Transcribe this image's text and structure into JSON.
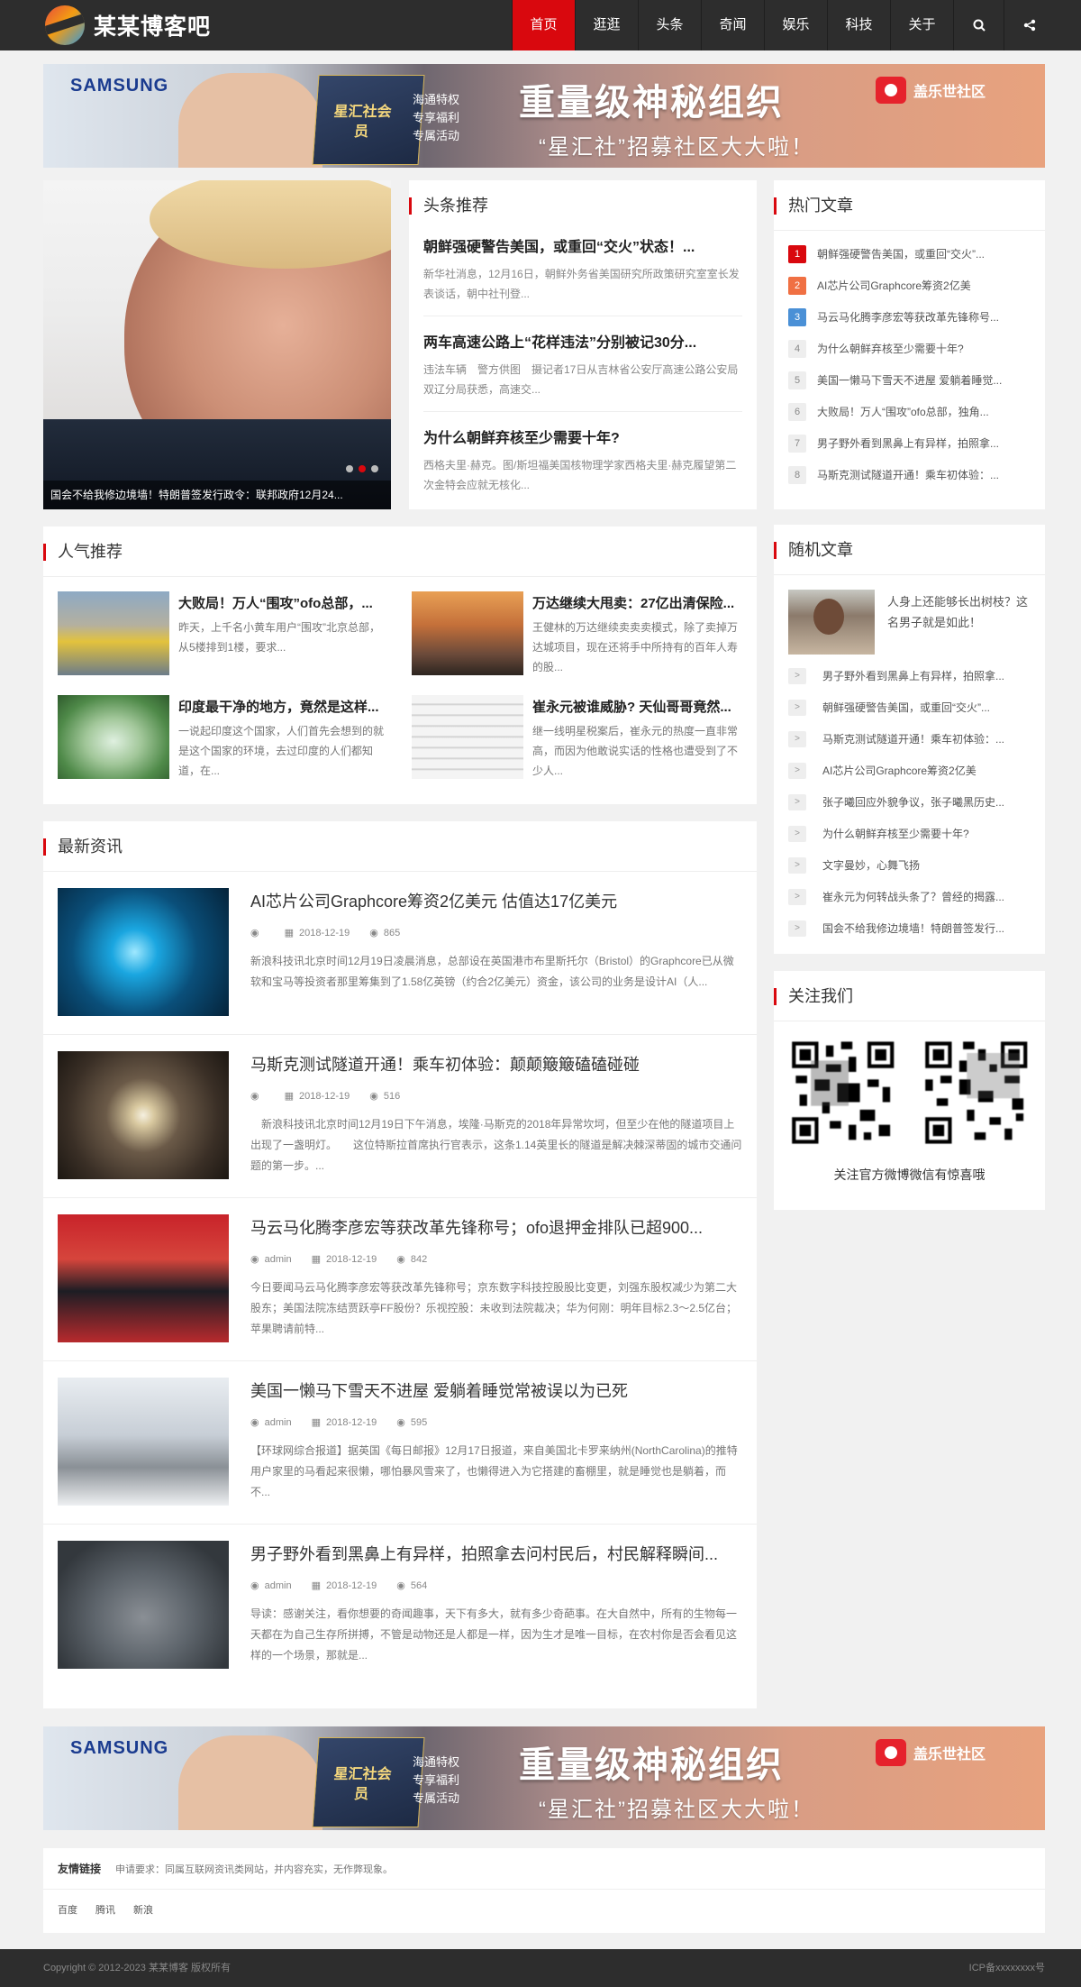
{
  "site": {
    "name": "某某博客吧"
  },
  "nav": {
    "items": [
      "首页",
      "逛逛",
      "头条",
      "奇闻",
      "娱乐",
      "科技",
      "关于"
    ],
    "active": 0,
    "search_icon": "search-icon",
    "share_icon": "share-icon"
  },
  "banner": {
    "brand_left": "SAMSUNG",
    "card": "星汇社会员",
    "perks": [
      "海通特权",
      "专享福利",
      "专属活动"
    ],
    "headline": "重量级神秘组织",
    "subline": "“星汇社”招募社区大大啦！",
    "brand_right": "盖乐世社区"
  },
  "slider": {
    "caption": "国会不给我修边境墙！特朗普签发行政令：联邦政府12月24..."
  },
  "headlines": {
    "title": "头条推荐",
    "items": [
      {
        "title": "朝鲜强硬警告美国，或重回“交火”状态！...",
        "desc": "新华社消息，12月16日，朝鲜外务省美国研究所政策研究室室长发表谈话，朝中社刊登..."
      },
      {
        "title": "两车高速公路上“花样违法”分别被记30分...",
        "desc": "违法车辆　警方供图　摄记者17日从吉林省公安厅高速公路公安局双辽分局获悉，高速交..."
      },
      {
        "title": "为什么朝鲜弃核至少需要十年?",
        "desc": "西格夫里·赫克。图/斯坦福美国核物理学家西格夫里·赫克履望第二次金特会应就无核化..."
      }
    ]
  },
  "hot": {
    "title": "热门文章",
    "items": [
      "朝鲜强硬警告美国，或重回“交火”...",
      "AI芯片公司Graphcore筹资2亿美",
      "马云马化腾李彦宏等获改革先锋称号...",
      "为什么朝鲜弃核至少需要十年?",
      "美国一懒马下雪天不进屋 爱躺着睡觉...",
      "大败局！万人“围攻”ofo总部，独角...",
      "男子野外看到黑鼻上有异样，拍照拿...",
      "马斯克测试隧道开通！乘车初体验：..."
    ]
  },
  "popular": {
    "title": "人气推荐",
    "items": [
      {
        "title": "大败局！万人“围攻”ofo总部，...",
        "desc": "昨天，上千名小黄车用户“围攻”北京总部，从5楼排到1楼，要求..."
      },
      {
        "title": "万达继续大甩卖：27亿出清保险...",
        "desc": "王健林的万达继续卖卖卖模式，除了卖掉万达城项目，现在还将手中所持有的百年人寿的股..."
      },
      {
        "title": "印度最干净的地方，竟然是这样...",
        "desc": "一说起印度这个国家，人们首先会想到的就是这个国家的环境，去过印度的人们都知道，在..."
      },
      {
        "title": "崔永元被谁威胁? 天仙哥哥竟然...",
        "desc": "继一线明星税案后，崔永元的热度一直非常高，而因为他敢说实话的性格也遭受到了不少人..."
      }
    ]
  },
  "latest": {
    "title": "最新资讯",
    "items": [
      {
        "title": "AI芯片公司Graphcore筹资2亿美元 估值达17亿美元",
        "author": "",
        "date": "2018-12-19",
        "views": "865",
        "desc": "新浪科技讯北京时间12月19日凌晨消息，总部设在英国港市布里斯托尔（Bristol）的Graphcore已从微软和宝马等投资者那里筹集到了1.58亿英镑（约合2亿美元）资金，该公司的业务是设计AI（人..."
      },
      {
        "title": "马斯克测试隧道开通！乘车初体验：颠颠簸簸磕磕碰碰",
        "author": "",
        "date": "2018-12-19",
        "views": "516",
        "desc": "　新浪科技讯北京时间12月19日下午消息，埃隆·马斯克的2018年异常坎坷，但至少在他的隧道项目上出现了一盏明灯。　　这位特斯拉首席执行官表示，这条1.14英里长的隧道是解决棘深蒂固的城市交通问题的第一步。..."
      },
      {
        "title": "马云马化腾李彦宏等获改革先锋称号；ofo退押金排队已超900...",
        "author": "admin",
        "date": "2018-12-19",
        "views": "842",
        "desc": "今日要闻马云马化腾李彦宏等获改革先锋称号；京东数字科技控股股比变更，刘强东股权减少为第二大股东；美国法院冻结贾跃亭FF股份？乐视控股：未收到法院裁决；华为何刚：明年目标2.3～2.5亿台；苹果聘请前特..."
      },
      {
        "title": "美国一懒马下雪天不进屋 爱躺着睡觉常被误以为已死",
        "author": "admin",
        "date": "2018-12-19",
        "views": "595",
        "desc": "【环球网综合报道】据英国《每日邮报》12月17日报道，来自美国北卡罗来纳州(NorthCarolina)的推特用户家里的马看起来很懒，哪怕暴风雪来了，也懒得进入为它搭建的畜棚里，就是睡觉也是躺着，而不..."
      },
      {
        "title": "男子野外看到黑鼻上有异样，拍照拿去问村民后，村民解释瞬间...",
        "author": "admin",
        "date": "2018-12-19",
        "views": "564",
        "desc": "导读：感谢关注，看你想要的奇闻趣事，天下有多大，就有多少奇葩事。在大自然中，所有的生物每一天都在为自己生存所拼搏，不管是动物还是人都是一样，因为生才是唯一目标，在农村你是否会看见这样的一个场景，那就是..."
      }
    ]
  },
  "random": {
    "title": "随机文章",
    "top": "人身上还能够长出树枝？这名男子就是如此！",
    "items": [
      "男子野外看到黑鼻上有异样，拍照拿...",
      "朝鲜强硬警告美国，或重回“交火”...",
      "马斯克测试隧道开通！乘车初体验：...",
      "AI芯片公司Graphcore筹资2亿美",
      "张子曦回应外貌争议，张子曦黑历史...",
      "为什么朝鲜弃核至少需要十年?",
      "文字曼妙，心舞飞扬",
      "崔永元为何转战头条了？曾经的揭露...",
      "国会不给我修边境墙！特朗普签发行..."
    ]
  },
  "follow": {
    "title": "关注我们",
    "caption": "关注官方微博微信有惊喜哦"
  },
  "links": {
    "title": "友情链接",
    "note": "申请要求：同属互联网资讯类网站，并内容充实，无作弊现象。",
    "items": [
      "百度",
      "腾讯",
      "新浪"
    ]
  },
  "footer": {
    "copyright": "Copyright © 2012-2023 某某博客 版权所有",
    "icp": "ICP备xxxxxxxx号"
  }
}
